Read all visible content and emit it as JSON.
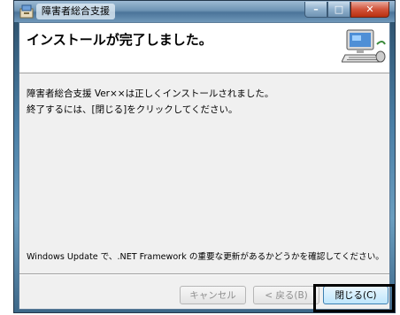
{
  "window": {
    "title": "障害者総合支援",
    "controls": {
      "minimize": "–",
      "maximize": "□",
      "close": "✕"
    }
  },
  "header": {
    "title": "インストールが完了しました。",
    "image": "computer-install-icon"
  },
  "body": {
    "line1": "障害者総合支援 Ver××は正しくインストールされました。",
    "line2": "終了するには、[閉じる]をクリックしてください。",
    "update_notice": "Windows Update で、.NET Framework の重要な更新があるかどうかを確認してください。"
  },
  "buttons": {
    "cancel": "キャンセル",
    "back": "< 戻る(B)",
    "close": "閉じる(C)"
  },
  "colors": {
    "titlebar": "#6e94b4",
    "close_button": "#d2543b",
    "dialog_bg": "#f0f0f0",
    "active_button": "#bee6fd"
  }
}
